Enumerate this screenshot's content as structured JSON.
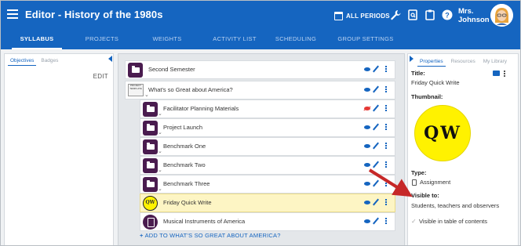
{
  "header": {
    "title": "Editor - History of the 1980s",
    "periods_label": "ALL PERIODS",
    "user_name_line1": "Mrs.",
    "user_name_line2": "Johnson"
  },
  "tabs": [
    {
      "label": "SYLLABUS",
      "active": true
    },
    {
      "label": "PROJECTS",
      "active": false
    },
    {
      "label": "WEIGHTS",
      "active": false
    },
    {
      "label": "ACTIVITY LIST",
      "active": false
    },
    {
      "label": "SCHEDULING",
      "active": false
    },
    {
      "label": "GROUP SETTINGS",
      "active": false
    }
  ],
  "left_panel": {
    "tabs": [
      "Objectives",
      "Badges"
    ],
    "edit_label": "EDIT"
  },
  "list": {
    "items": [
      {
        "label": "Second Semester",
        "icon": "folder-icon"
      },
      {
        "label": "What's so Great about America?",
        "icon": "template-thumbnail"
      },
      {
        "label": "Facilitator Planning Materials",
        "icon": "folder-icon",
        "hidden": true
      },
      {
        "label": "Project Launch",
        "icon": "folder-icon"
      },
      {
        "label": "Benchmark One",
        "icon": "folder-icon"
      },
      {
        "label": "Benchmark Two",
        "icon": "folder-icon"
      },
      {
        "label": "Benchmark Three",
        "icon": "folder-icon"
      },
      {
        "label": "Friday Quick Write",
        "icon": "qw-icon",
        "selected": true
      },
      {
        "label": "Musical Instruments of America",
        "icon": "document-icon"
      }
    ],
    "template_icon_text": "PROJECT TEMPLATE",
    "qw_icon_text": "QW",
    "add_link": "ADD TO WHAT'S SO GREAT ABOUT AMERICA?"
  },
  "right_panel": {
    "tabs": [
      "Properties",
      "Resources",
      "My Library"
    ],
    "title_label": "Title:",
    "title_value": "Friday Quick Write",
    "thumbnail_label": "Thumbnail:",
    "thumbnail_text": "QW",
    "type_label": "Type:",
    "type_value": "Assignment",
    "visible_label": "Visible to:",
    "visible_value": "Students, teachers and observers",
    "toc_label": "Visible in table of contents"
  },
  "colors": {
    "brand_blue": "#1565c0",
    "icon_purple": "#4a1c4f",
    "selected_row": "#fdf5c4",
    "qw_yellow": "#fff200",
    "annotation_arrow": "#c62828"
  }
}
